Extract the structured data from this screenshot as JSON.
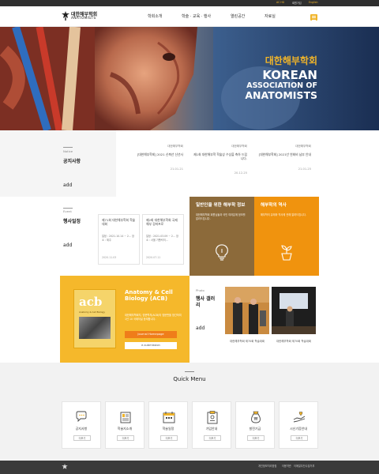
{
  "topbar": {
    "links": [
      "AC HG",
      "회원가입",
      "English"
    ]
  },
  "header": {
    "logo_ko": "대한해부학회",
    "logo_en": "ANATOMISTS",
    "nav": [
      "학회소개",
      "학술 · 교육 · 행사",
      "열린공간",
      "자료실"
    ]
  },
  "hero": {
    "ko": "대한해부학회",
    "en1": "KOREAN",
    "en2": "ASSOCIATION OF",
    "en3": "ANATOMISTS"
  },
  "notice": {
    "small": "Notice",
    "title": "공지사항",
    "add": "add",
    "items": [
      {
        "category": "대한해부학회",
        "title": "[대한해부학회] 2021 신축년 신년사",
        "date": "21-01-21"
      },
      {
        "category": "대한해부학회",
        "title": "제1회 대한해부학 학술상 수상을 축하 드립니다.",
        "date": "20-12-25"
      },
      {
        "category": "대한해부학회",
        "title": "[대한해부학회] 2021년 연회비 납부 안내",
        "date": "21-01-25"
      }
    ]
  },
  "event": {
    "small": "Event",
    "title": "행사일정",
    "add": "add",
    "cards": [
      {
        "title": "제71회 대한해부학회 학술대회",
        "body": "일정 : 2021.10.14 ~ 2... 장소 : 제주",
        "date": "2020.11.03"
      },
      {
        "title": "제2회 대한해부학회 국제해부 강좌프로",
        "body": "일정 : 2021.03.09 ~ 2... 장소 : 서울 가톨릭의...",
        "date": "2020.07.11"
      }
    ]
  },
  "info_boxes": [
    {
      "title": "일반인을 위한 해부학 정보",
      "desc": "대한해부학회 회원님들과 국민 여러분께 정보를 알려드립니다.",
      "color": "#8c6a3a"
    },
    {
      "title": "해부학의 역사",
      "desc": "해부학의 유래와 역사에 관해 알려드립니다.",
      "color": "#f0930e"
    }
  ],
  "journal": {
    "cover_title": "acb",
    "cover_sub": "Anatomy & Cell Biology",
    "title": "Anatomy & Cell Biology (ACB)",
    "desc": "대한해부학회지, 영문학지(ACB)의 영문판을 창간하여 1년 10 국제저널 등재합니다.",
    "btn_home": "Journal Homepage",
    "btn_submit": "e-submission"
  },
  "photo": {
    "small": "Photo",
    "title": "행사 갤러리",
    "add": "add",
    "captions": [
      "대한해부학회 제70회 학술대회",
      "대한해부학회 제70회 학술대회"
    ]
  },
  "quick_menu": {
    "title": "Quick Menu",
    "items": [
      {
        "label": "공지사항",
        "icon": "speech-bubble-icon",
        "more": "더보기"
      },
      {
        "label": "학술지소개",
        "icon": "journal-stack-icon",
        "more": "더보기"
      },
      {
        "label": "학술일정",
        "icon": "calendar-icon",
        "more": "더보기"
      },
      {
        "label": "가입안내",
        "icon": "clipboard-icon",
        "more": "더보기"
      },
      {
        "label": "발전기금",
        "icon": "money-bag-icon",
        "more": "더보기"
      },
      {
        "label": "시신기증안내",
        "icon": "donation-hands-icon",
        "more": "더보기"
      }
    ]
  },
  "footer": {
    "links": [
      "개인정보처리방침",
      "이용약관",
      "이메일무단수집거부"
    ]
  },
  "colors": {
    "accent": "#f0b429",
    "brown": "#8c6a3a",
    "orange": "#f0930e",
    "footer": "#3a3a3a"
  }
}
